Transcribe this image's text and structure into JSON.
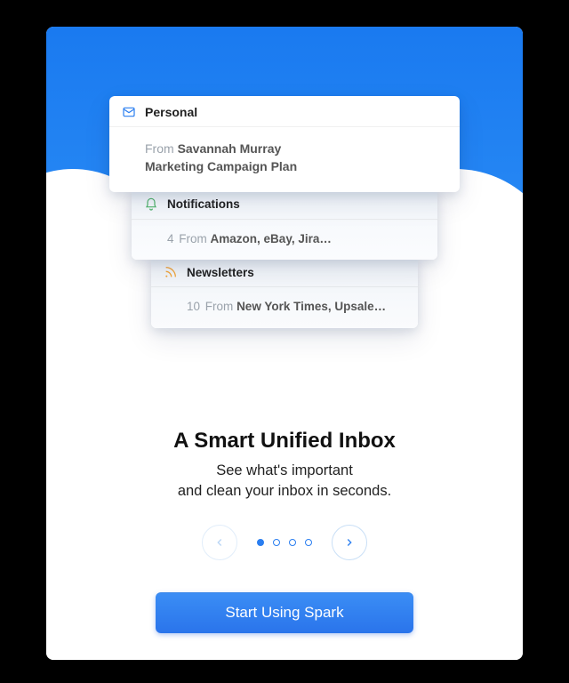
{
  "cards": {
    "personal": {
      "title": "Personal",
      "from_label": "From",
      "from_name": "Savannah Murray",
      "subject": "Marketing Campaign Plan"
    },
    "notifications": {
      "title": "Notifications",
      "count": "4",
      "from_label": "From",
      "from_names": "Amazon, eBay, Jira…"
    },
    "newsletters": {
      "title": "Newsletters",
      "count": "10",
      "from_label": "From",
      "from_names": "New York Times, Upsale…"
    }
  },
  "headline": {
    "title": "A Smart Unified Inbox",
    "line1": "See what's important",
    "line2": "and clean your inbox in seconds."
  },
  "pager": {
    "total": 4,
    "active_index": 0
  },
  "cta": {
    "label": "Start Using Spark"
  },
  "colors": {
    "accent": "#2a7ef0",
    "mail_icon": "#2a7ef0",
    "bell_icon": "#4fb36a",
    "rss_icon": "#f4a63a"
  }
}
